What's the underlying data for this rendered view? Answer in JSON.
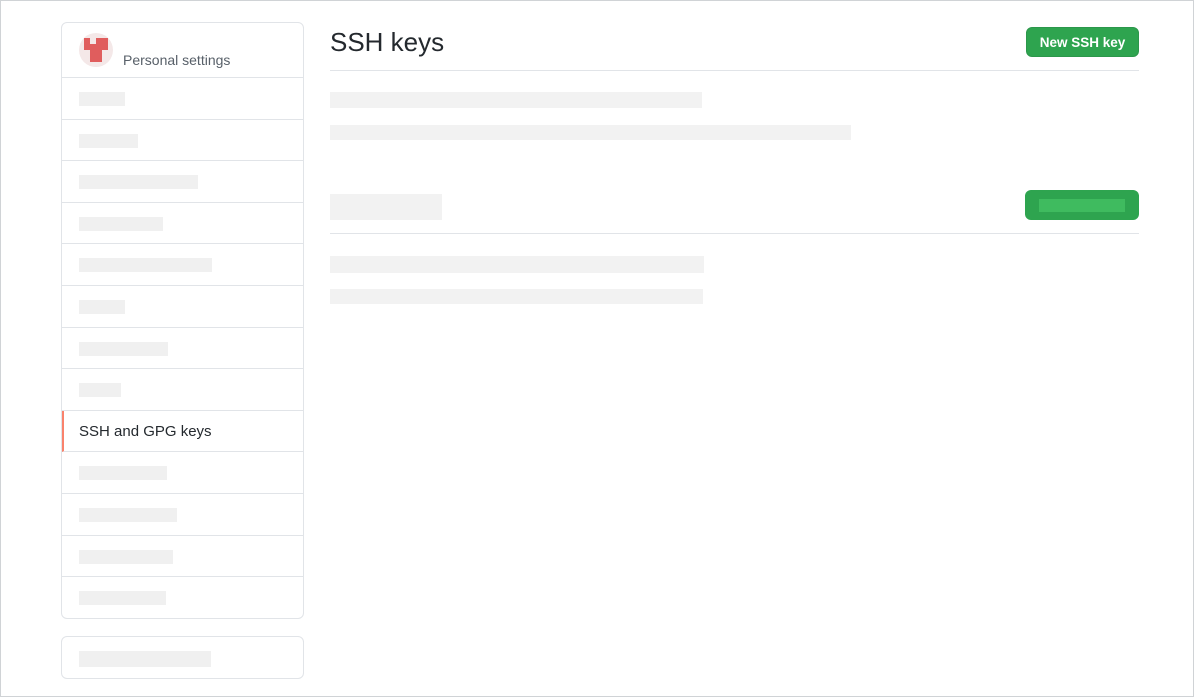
{
  "sidebar": {
    "header_label": "Personal settings",
    "selected_item_label": "SSH and GPG keys"
  },
  "main": {
    "title": "SSH keys",
    "new_key_button_label": "New SSH key"
  },
  "colors": {
    "primary_button": "#2ea44f",
    "selected_indicator": "#f9826c",
    "placeholder": "#f0f0f0"
  }
}
